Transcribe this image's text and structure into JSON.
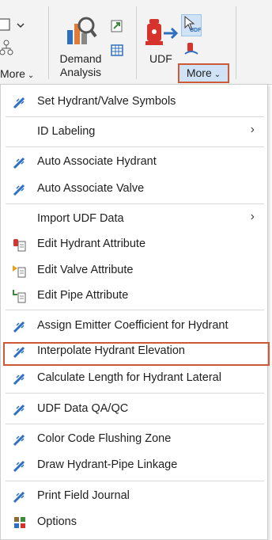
{
  "ribbon": {
    "left_more_label": "More",
    "demand_analysis_label_1": "Demand",
    "demand_analysis_label_2": "Analysis",
    "udf_label": "UDF",
    "udf_icon_text": "UDF",
    "more_button_label": "More"
  },
  "menu": {
    "items": [
      {
        "label": "Set Hydrant/Valve Symbols",
        "icon": "hydrant-valve-wand-icon"
      },
      {
        "label": "ID Labeling",
        "icon": "",
        "submenu": true
      },
      {
        "label": "Auto Associate Hydrant",
        "icon": "wand-icon"
      },
      {
        "label": "Auto Associate Valve",
        "icon": "wand-icon"
      },
      {
        "label": "Import UDF Data",
        "icon": "",
        "submenu": true
      },
      {
        "label": "Edit Hydrant Attribute",
        "icon": "hydrant-document-icon"
      },
      {
        "label": "Edit Valve Attribute",
        "icon": "valve-document-icon"
      },
      {
        "label": "Edit Pipe Attribute",
        "icon": "pipe-document-icon"
      },
      {
        "label": "Assign Emitter Coefficient for Hydrant",
        "icon": "wand-icon"
      },
      {
        "label": "Interpolate Hydrant Elevation",
        "icon": "wand-icon"
      },
      {
        "label": "Calculate Length for Hydrant Lateral",
        "icon": "wand-icon"
      },
      {
        "label": "UDF Data QA/QC",
        "icon": "wand-icon"
      },
      {
        "label": "Color Code Flushing Zone",
        "icon": "wand-icon"
      },
      {
        "label": "Draw Hydrant-Pipe Linkage",
        "icon": "wand-icon"
      },
      {
        "label": "Print Field Journal",
        "icon": "wand-icon"
      },
      {
        "label": "Options",
        "icon": "options-grid-icon"
      }
    ],
    "submenu_arrow": "›"
  },
  "colors": {
    "highlight_border": "#cc5a36",
    "more_button_bg": "#cfe2f6",
    "wand_blue": "#2e6fbf"
  }
}
